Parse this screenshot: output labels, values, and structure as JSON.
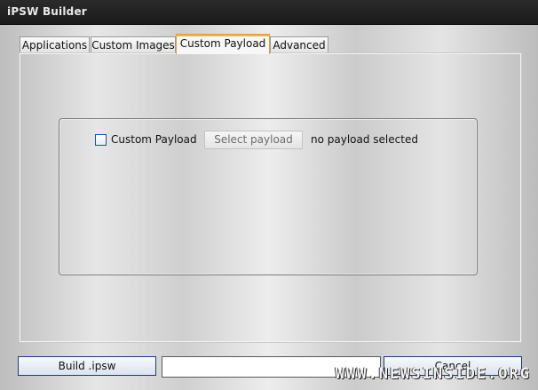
{
  "window": {
    "title": "iPSW Builder"
  },
  "tabs": [
    {
      "label": "Applications",
      "active": false
    },
    {
      "label": "Custom Images",
      "active": false
    },
    {
      "label": "Custom Payload",
      "active": true
    },
    {
      "label": "Advanced",
      "active": false
    }
  ],
  "payload": {
    "checkbox_label": "Custom Payload",
    "checked": false,
    "select_button": "Select payload",
    "status": "no payload selected"
  },
  "footer": {
    "build_button": "Build .ipsw",
    "path_value": "",
    "cancel_button": "Cancel"
  },
  "watermark": "WWW.NEWSINSIDE.ORG",
  "colors": {
    "active_tab_accent": "#f0b54a",
    "button_border": "#1a3f73"
  }
}
